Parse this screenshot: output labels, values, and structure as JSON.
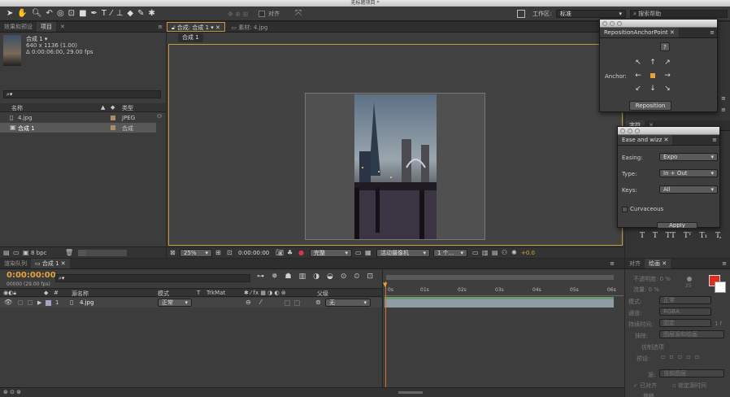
{
  "window": {
    "title": "无标题项目 *"
  },
  "toolbar": {
    "snap_label": "对齐",
    "workspace_label": "工作区:",
    "workspace_value": "标准",
    "help_placeholder": "搜索帮助"
  },
  "project": {
    "tab_effects": "效果和预设",
    "tab_project": "项目",
    "comp_name": "合成 1 ▾",
    "comp_size": "640 x 1136 (1.00)",
    "comp_duration": "Δ 0:00:06:00, 29.00 fps",
    "col_name": "名称",
    "col_type": "类型",
    "items": [
      {
        "name": "4.jpg",
        "type": "JPEG"
      },
      {
        "name": "合成 1",
        "type": "合成"
      }
    ],
    "bpc": "8 bpc"
  },
  "viewer": {
    "tab_comp": "合成: 合成 1",
    "tab_footage": "素材: 4.jpg",
    "crumb": "合成 1",
    "zoom": "25%",
    "timecode": "0:00:00:00",
    "quality": "完整",
    "camera": "活动摄像机",
    "views": "1 个...",
    "exposure": "+0.0"
  },
  "anchor": {
    "title": "RepositionAnchorPoint",
    "help": "?",
    "label": "Anchor:",
    "button": "Reposition"
  },
  "ease": {
    "title": "Ease and wizz",
    "easing_label": "Easing:",
    "easing_value": "Expo",
    "type_label": "Type:",
    "type_value": "In + Out",
    "keys_label": "Keys:",
    "keys_value": "All",
    "curvaceous": "Curvaceous",
    "apply": "Apply"
  },
  "character": {
    "tab": "字符",
    "styles": [
      "T",
      "T",
      "TT",
      "Tᵀ",
      "T₁",
      "T,"
    ]
  },
  "timeline": {
    "tab_render": "渲染队列",
    "tab_comp": "合成 1",
    "timecode": "0:00:00:00",
    "frames": "00000 (29.00 fps)",
    "col_source": "源名称",
    "col_mode": "模式",
    "col_t": "T",
    "col_trkmat": "TrkMat",
    "col_parent": "父级",
    "layer_index": "1",
    "layer_name": "4.jpg",
    "layer_mode": "正常",
    "layer_parent": "无",
    "ruler": [
      "0s",
      "01s",
      "02s",
      "03s",
      "04s",
      "05s",
      "06s"
    ]
  },
  "paint": {
    "tab_align": "对齐",
    "tab_paint": "绘画",
    "opacity_label": "不透明度:",
    "opacity_value": "0 %",
    "flow_label": "流量:",
    "flow_value": "0 %",
    "brush_size": "25",
    "mode_label": "模式:",
    "mode_value": "正常",
    "channels_label": "通道:",
    "channels_value": "RGBA",
    "duration_label": "持续时间:",
    "duration_value": "固定",
    "duration_frames": "1 f",
    "erase_label": "抹除:",
    "erase_value": "图层源和绘画",
    "clone_label": "仿制选项",
    "preset_label": "预设:",
    "source_label": "源:",
    "source_value": "当前图层",
    "aligned": "已对齐",
    "lock_time": "锁定源时间",
    "offset_label": "偏移"
  },
  "colors": {
    "fg": "#e22b1a",
    "bg": "#ffffff",
    "accent": "#e8a23a",
    "timecode": "#e8a23a",
    "layer_bar": "#8f9ca3",
    "work_bar": "#6f9c6f"
  }
}
